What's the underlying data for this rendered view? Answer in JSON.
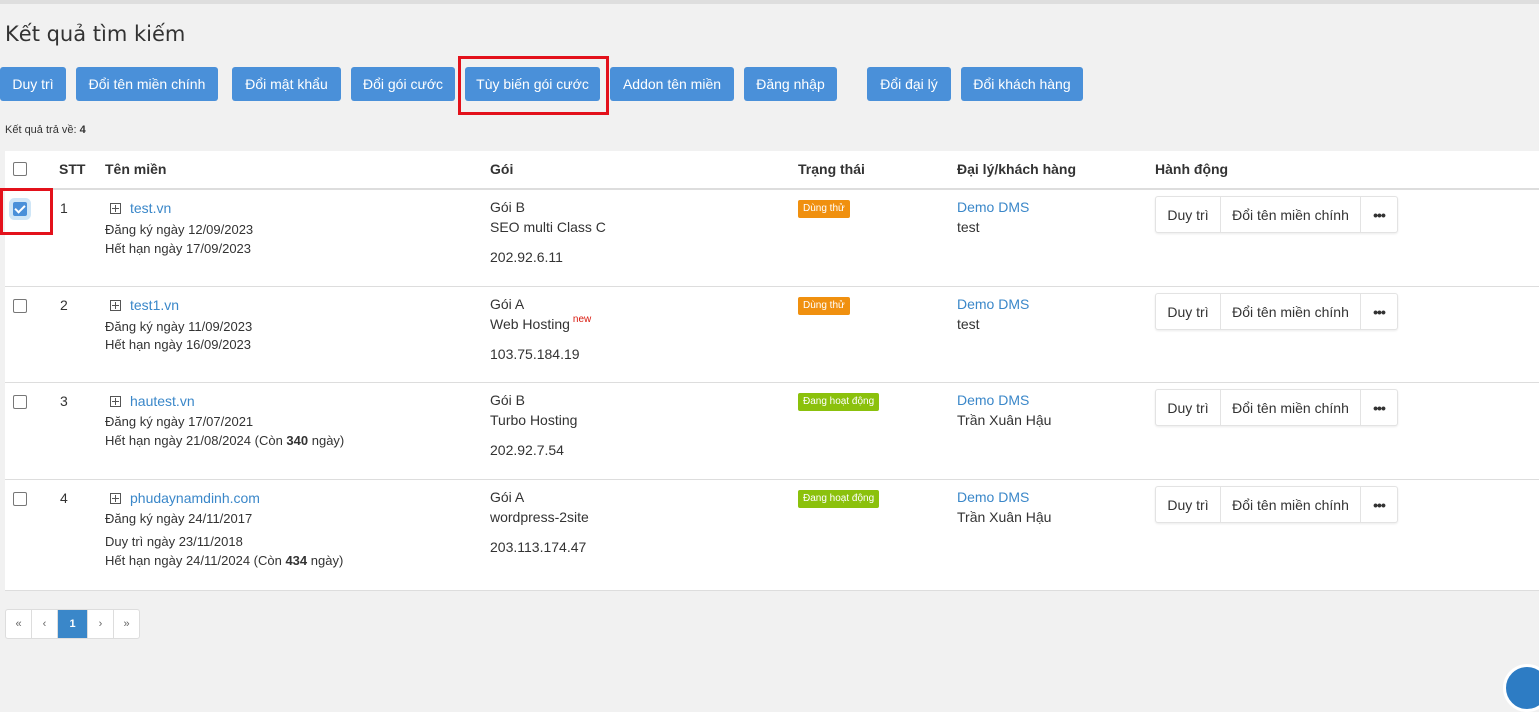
{
  "page": {
    "title": "Kết quả tìm kiếm",
    "result_label": "Kết quả trả về:",
    "result_count": "4"
  },
  "toolbar": {
    "buttons": [
      {
        "label": "Duy trì"
      },
      {
        "label": "Đổi tên miền chính"
      },
      {
        "label": "Đổi mật khẩu"
      },
      {
        "label": "Đổi gói cước"
      },
      {
        "label": "Tùy biến gói cước"
      },
      {
        "label": "Addon tên miền"
      },
      {
        "label": "Đăng nhập"
      },
      {
        "label": "Đổi đại lý"
      },
      {
        "label": "Đổi khách hàng"
      }
    ]
  },
  "table": {
    "headers": {
      "stt": "STT",
      "domain": "Tên miền",
      "package": "Gói",
      "status": "Trạng thái",
      "agent": "Đại lý/khách hàng",
      "action": "Hành động"
    },
    "rows": [
      {
        "checked": true,
        "stt": "1",
        "domain": "test.vn",
        "registered": "Đăng ký ngày 12/09/2023",
        "renewed": "",
        "expires_prefix": "Hết hạn ngày 17/09/2023",
        "expires_days": "",
        "expires_suffix": "",
        "package": "Gói B",
        "plan": "SEO multi Class C",
        "plan_new": "",
        "ip": "202.92.6.11",
        "status": "Dùng thử",
        "status_color": "#f0900f",
        "agent": "Demo DMS",
        "customer": "test",
        "act_renew": "Duy trì",
        "act_rename": "Đổi tên miền chính",
        "act_more": "•••"
      },
      {
        "checked": false,
        "stt": "2",
        "domain": "test1.vn",
        "registered": "Đăng ký ngày 11/09/2023",
        "renewed": "",
        "expires_prefix": "Hết hạn ngày 16/09/2023",
        "expires_days": "",
        "expires_suffix": "",
        "package": "Gói A",
        "plan": "Web Hosting",
        "plan_new": "new",
        "ip": "103.75.184.19",
        "status": "Dùng thử",
        "status_color": "#f0900f",
        "agent": "Demo DMS",
        "customer": "test",
        "act_renew": "Duy trì",
        "act_rename": "Đổi tên miền chính",
        "act_more": "•••"
      },
      {
        "checked": false,
        "stt": "3",
        "domain": "hautest.vn",
        "registered": "Đăng ký ngày 17/07/2021",
        "renewed": "",
        "expires_prefix": "Hết hạn ngày 21/08/2024 (Còn ",
        "expires_days": "340",
        "expires_suffix": " ngày)",
        "package": "Gói B",
        "plan": "Turbo Hosting",
        "plan_new": "",
        "ip": "202.92.7.54",
        "status": "Đang hoạt động",
        "status_color": "#8bc10c",
        "agent": "Demo DMS",
        "customer": "Trần Xuân Hậu",
        "act_renew": "Duy trì",
        "act_rename": "Đổi tên miền chính",
        "act_more": "•••"
      },
      {
        "checked": false,
        "stt": "4",
        "domain": "phudaynamdinh.com",
        "registered": "Đăng ký ngày 24/11/2017",
        "renewed": "Duy trì ngày 23/11/2018",
        "expires_prefix": "Hết hạn ngày 24/11/2024 (Còn ",
        "expires_days": "434",
        "expires_suffix": " ngày)",
        "package": "Gói A",
        "plan": "wordpress-2site",
        "plan_new": "",
        "ip": "203.113.174.47",
        "status": "Đang hoạt động",
        "status_color": "#8bc10c",
        "agent": "Demo DMS",
        "customer": "Trần Xuân Hậu",
        "act_renew": "Duy trì",
        "act_rename": "Đổi tên miền chính",
        "act_more": "•••"
      }
    ]
  },
  "pagination": {
    "first": "«",
    "prev": "‹",
    "current": "1",
    "next": "›",
    "last": "»"
  },
  "colors": {
    "button_bg": "#4a90d9",
    "highlight": "#e3111b",
    "link": "#3a87c9",
    "trial": "#f0900f",
    "active": "#8bc10c"
  }
}
